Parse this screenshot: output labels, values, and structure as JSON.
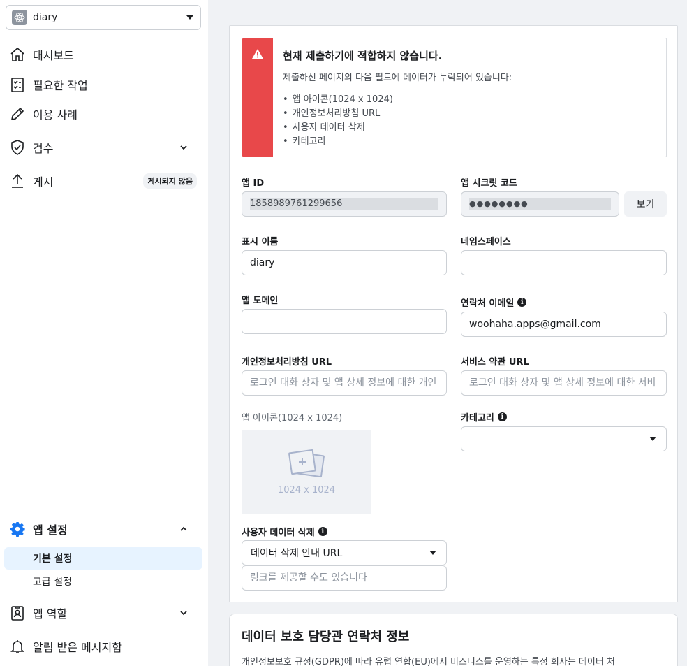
{
  "sidebar": {
    "app_name": "diary",
    "nav": [
      {
        "label": "대시보드",
        "icon": "home-icon"
      },
      {
        "label": "필요한 작업",
        "icon": "clipboard-check-icon"
      },
      {
        "label": "이용 사례",
        "icon": "pencil-icon"
      },
      {
        "label": "검수",
        "icon": "shield-check-icon"
      },
      {
        "label": "게시",
        "icon": "upload-icon",
        "badge": "게시되지 않음"
      }
    ],
    "settings": {
      "label": "앱 설정",
      "sub": [
        "기본 설정",
        "고급 설정"
      ]
    },
    "roles": {
      "label": "앱 역할"
    },
    "notifications": {
      "label": "알림 받은 메시지함"
    }
  },
  "alert": {
    "title": "현재 제출하기에 적합하지 않습니다.",
    "desc": "제출하신 페이지의 다음 필드에 데이터가 누락되어 있습니다:",
    "items": [
      "앱 아이콘(1024 x 1024)",
      "개인정보처리방침 URL",
      "사용자 데이터 삭제",
      "카테고리"
    ]
  },
  "form": {
    "app_id_label": "앱 ID",
    "app_id_value": "1858989761299656",
    "secret_label": "앱 시크릿 코드",
    "secret_value": "●●●●●●●●",
    "show_button": "보기",
    "display_name_label": "표시 이름",
    "display_name_value": "diary",
    "namespace_label": "네임스페이스",
    "namespace_value": "",
    "domain_label": "앱 도메인",
    "domain_value": "",
    "email_label": "연락처 이메일",
    "email_value": "woohaha.apps@gmail.com",
    "privacy_label": "개인정보처리방침 URL",
    "privacy_placeholder": "로그인 대화 상자 및 앱 상세 정보에 대한 개인",
    "terms_label": "서비스 약관 URL",
    "terms_placeholder": "로그인 대화 상자 및 앱 상세 정보에 대한 서비",
    "icon_label": "앱 아이콘(1024 x 1024)",
    "icon_dim": "1024 x 1024",
    "category_label": "카테고리",
    "category_value": "",
    "deletion_label": "사용자 데이터 삭제",
    "deletion_select": "데이터 삭제 안내 URL",
    "deletion_placeholder": "링크를 제공할 수도 있습니다"
  },
  "dpo": {
    "title": "데이터 보호 담당관 연락처 정보",
    "desc": "개인정보보호 규정(GDPR)에 따라 유럽 연합(EU)에서 비즈니스를 운영하는 특정 회사는 데이터 처"
  },
  "colors": {
    "alert": "#e8484a",
    "accent": "#1877f2",
    "active_bg": "#e7f3ff"
  }
}
